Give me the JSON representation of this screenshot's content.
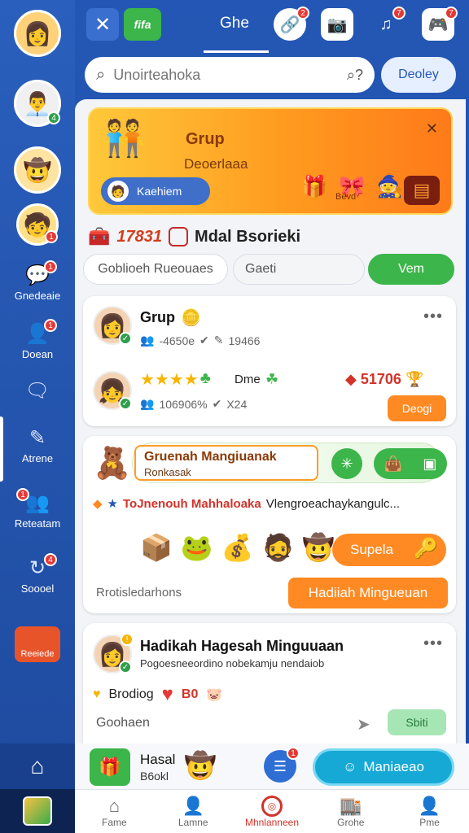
{
  "colors": {
    "primary": "#2457b5",
    "accent": "#ff8a24",
    "success": "#3cb54a",
    "danger": "#e53935"
  },
  "topbar": {
    "title": "Ghe",
    "logo_label": "fifa"
  },
  "sidebar": {
    "items": [
      {
        "label": "Gnedeaie",
        "badge": "1"
      },
      {
        "label": "Doean",
        "badge": "1"
      },
      {
        "label": "",
        "badge": ""
      },
      {
        "label": "Atrene",
        "badge": ""
      },
      {
        "label": "Reteatam",
        "badge": "1"
      },
      {
        "label": "Soooel",
        "badge": "4"
      },
      {
        "label": "Reeiede",
        "badge": ""
      }
    ],
    "avatar_badges": [
      "",
      "4",
      "",
      "1"
    ]
  },
  "search": {
    "placeholder": "Unoirteahoka",
    "display_button": "Deoley"
  },
  "promo": {
    "title": "Grup",
    "subtitle": "Deoerlaaa",
    "pill_label": "Kaehiem",
    "icon_text": "Bevd"
  },
  "stats": {
    "number": "17831",
    "label": "Mdal Bsorieki"
  },
  "filters": [
    "Goblioeh Rueouaes",
    "Gaeti",
    "Vem"
  ],
  "card1": {
    "title": "Grup",
    "meta1": "-4650e",
    "meta1b": "19466",
    "label": "Dme",
    "meta2": "106906%",
    "meta2b": "X24",
    "score": "51706",
    "button": "Deogi"
  },
  "card2": {
    "banner_title": "Gruenah Mangiuanak",
    "banner_sub": "Ronkasak",
    "highlight": "ToJnenouh Mahhaloaka",
    "rest": "Vlengroeachaykangulc...",
    "super_button": "Supela",
    "footer": "Rrotisledarhons",
    "weekly_button": "Hadiiah Mingueuan"
  },
  "card3": {
    "title": "Hadikah Hagesah Minguuaan",
    "subtitle": "Pogoesneeordino nobekamju nendaiob",
    "status": "Brodiog",
    "num": "B0",
    "footer": "Goohaen",
    "button": "Sbiti"
  },
  "actionbar": {
    "title": "Hasal",
    "subtitle": "B6okl",
    "badge": "1",
    "main_button": "Maniaeao"
  },
  "bottomnav": [
    {
      "label": "Fame",
      "icon": "home-icon"
    },
    {
      "label": "Lamne",
      "icon": "person-icon"
    },
    {
      "label": "Mhnlanneen",
      "icon": "target-icon"
    },
    {
      "label": "Grohe",
      "icon": "shop-icon"
    },
    {
      "label": "Pme",
      "icon": "profile-icon"
    }
  ]
}
